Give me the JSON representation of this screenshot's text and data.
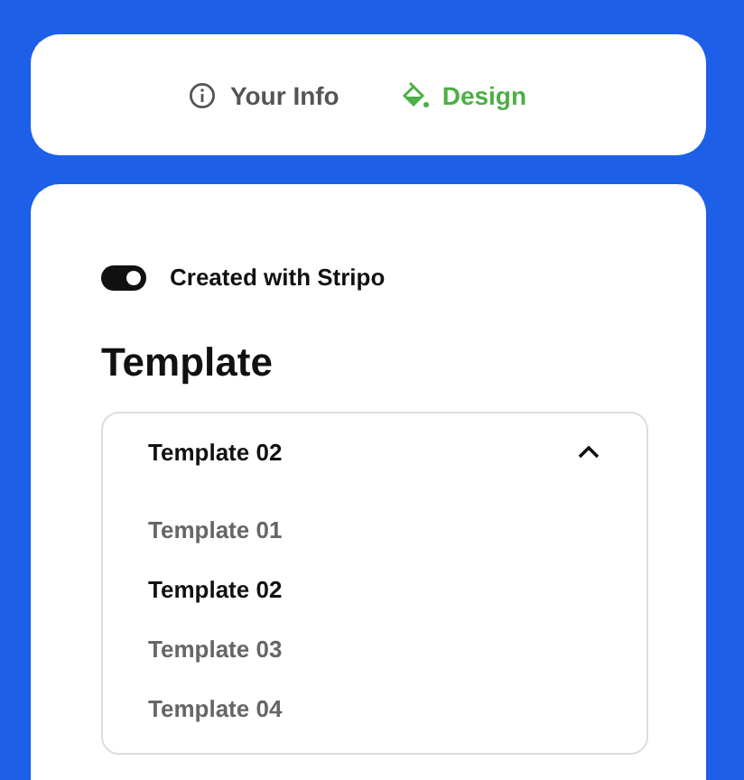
{
  "tabs": [
    {
      "label": "Your Info",
      "selected": false
    },
    {
      "label": "Design",
      "selected": true
    }
  ],
  "toggle": {
    "label": "Created with Stripo",
    "on": true
  },
  "section_title": "Template",
  "dropdown": {
    "value": "Template 02",
    "expanded": true,
    "options": [
      {
        "label": "Template 01",
        "selected": false
      },
      {
        "label": "Template 02",
        "selected": true
      },
      {
        "label": "Template 03",
        "selected": false
      },
      {
        "label": "Template 04",
        "selected": false
      }
    ]
  }
}
